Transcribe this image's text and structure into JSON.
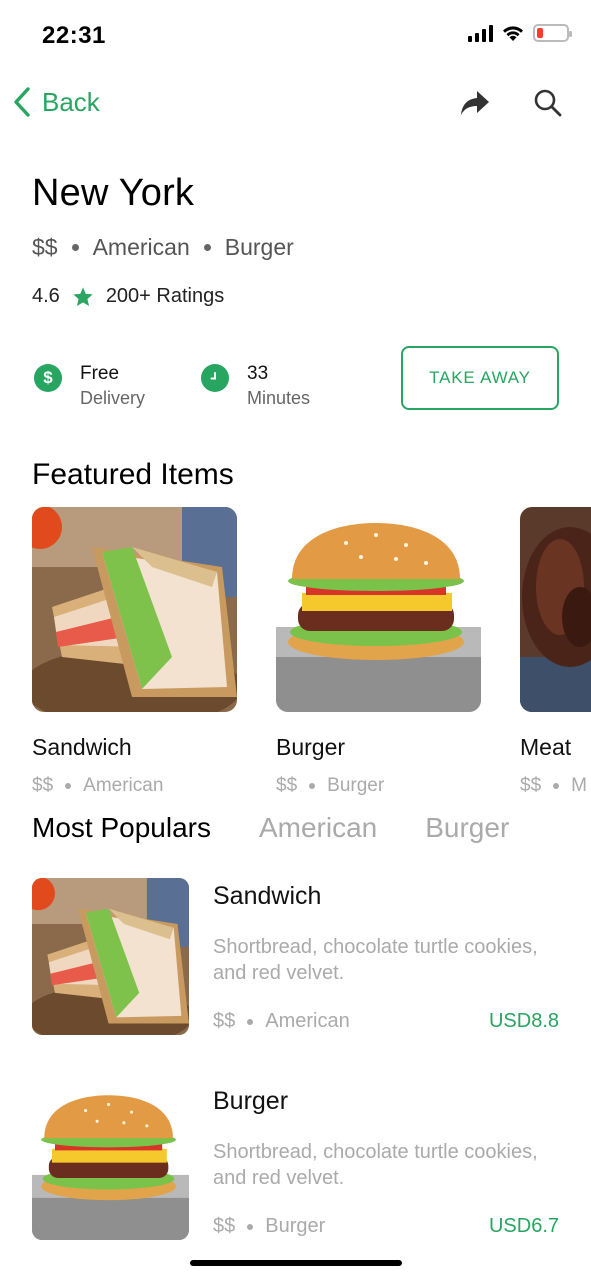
{
  "status": {
    "time": "22:31"
  },
  "nav": {
    "back_label": "Back"
  },
  "restaurant": {
    "name": "New York",
    "price_level": "$$",
    "cuisine_1": "American",
    "cuisine_2": "Burger",
    "rating": "4.6",
    "ratings_count": "200+ Ratings"
  },
  "info": {
    "delivery_main": "Free",
    "delivery_sub": "Delivery",
    "delivery_icon": "$",
    "time_main": "33",
    "time_sub": "Minutes",
    "takeaway_label": "TAKE AWAY"
  },
  "featured": {
    "title": "Featured Items",
    "items": [
      {
        "name": "Sandwich",
        "price": "$$",
        "category": "American",
        "image": "sandwich"
      },
      {
        "name": "Burger",
        "price": "$$",
        "category": "Burger",
        "image": "burger"
      },
      {
        "name": "Meat",
        "price": "$$",
        "category": "M",
        "image": "meat"
      }
    ]
  },
  "tabs": [
    {
      "label": "Most Populars",
      "active": true
    },
    {
      "label": "American",
      "active": false
    },
    {
      "label": "Burger",
      "active": false
    }
  ],
  "populars": [
    {
      "name": "Sandwich",
      "description": "Shortbread, chocolate turtle cookies, and red velvet.",
      "price_level": "$$",
      "category": "American",
      "price": "USD8.8",
      "image": "sandwich"
    },
    {
      "name": "Burger",
      "description": "Shortbread, chocolate turtle cookies, and red velvet.",
      "price_level": "$$",
      "category": "Burger",
      "price": "USD6.7",
      "image": "burger"
    }
  ],
  "colors": {
    "accent": "#27a561",
    "muted": "#aaaaaa",
    "battery_low": "#ff3b30"
  }
}
